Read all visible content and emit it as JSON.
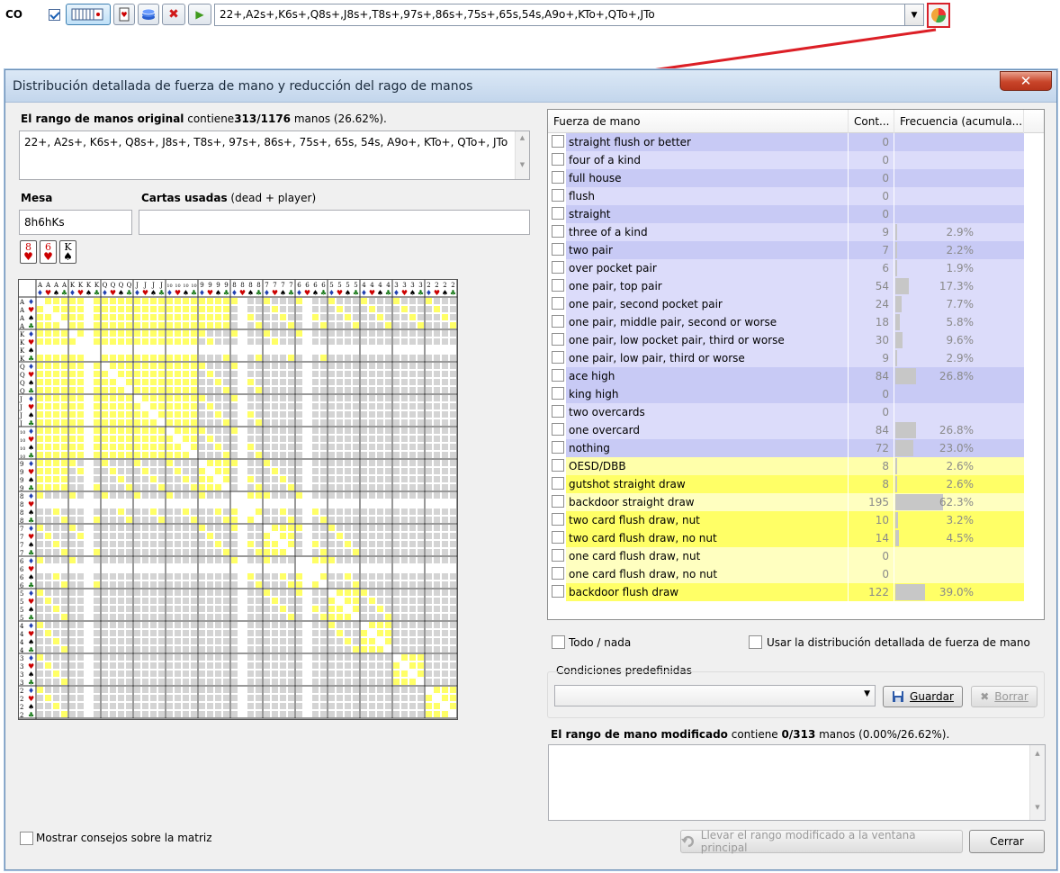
{
  "toolbar": {
    "position_label": "CO",
    "range_text": "22+,A2s+,K6s+,Q8s+,J8s+,T8s+,97s+,86s+,75s+,65s,54s,A9o+,KTo+,QTo+,JTo",
    "dropdown_arrow": "▼",
    "remove_glyph": "✖",
    "go_glyph": "▶"
  },
  "dialog": {
    "title": "Distribución detallada de fuerza de mano y reducción del rago de manos",
    "close_glyph": "✕",
    "original_range": {
      "label_bold": "El rango de manos original",
      "label_mid": " contiene",
      "count_bold": "313/1176",
      "label_tail": " manos (26.62%).",
      "text": "22+, A2s+, K6s+, Q8s+, J8s+, T8s+, 97s+, 86s+, 75s+, 65s, 54s, A9o+, KTo+, QTo+, JTo"
    },
    "board": {
      "label": "Mesa",
      "value": "8h6hKs"
    },
    "dead": {
      "label_bold": "Cartas usadas",
      "label_tail": " (dead + player)",
      "value": ""
    },
    "board_cards": [
      {
        "rank": "8",
        "suit": "♥"
      },
      {
        "rank": "6",
        "suit": "♥"
      },
      {
        "rank": "K",
        "suit": "♠"
      }
    ],
    "matrix": {
      "ranks": [
        "A",
        "K",
        "Q",
        "J",
        "10",
        "9",
        "8",
        "7",
        "6",
        "5",
        "4",
        "3",
        "2"
      ],
      "suits": [
        "♦",
        "♥",
        "♠",
        "♣"
      ],
      "colors": {
        "in_range": "#ffff66",
        "out_range": "#d4d4d4",
        "blocked": "#ffffff"
      }
    },
    "hand_strength": {
      "headers": [
        "Fuerza de mano",
        "Cont...",
        "Frecuencia (acumula..."
      ],
      "rows": [
        {
          "name": "straight flush or better",
          "count": "0",
          "pct": "",
          "freq": 0,
          "color": "#c8caf5"
        },
        {
          "name": "four of a kind",
          "count": "0",
          "pct": "",
          "freq": 0,
          "color": "#dcdcfa"
        },
        {
          "name": "full house",
          "count": "0",
          "pct": "",
          "freq": 0,
          "color": "#c8caf5"
        },
        {
          "name": "flush",
          "count": "0",
          "pct": "",
          "freq": 0,
          "color": "#dcdcfa"
        },
        {
          "name": "straight",
          "count": "0",
          "pct": "",
          "freq": 0,
          "color": "#c8caf5"
        },
        {
          "name": "three of a kind",
          "count": "9",
          "pct": "2.9%",
          "freq": 2.9,
          "color": "#dcdcfa"
        },
        {
          "name": "two pair",
          "count": "7",
          "pct": "2.2%",
          "freq": 2.2,
          "color": "#c8caf5"
        },
        {
          "name": "over pocket pair",
          "count": "6",
          "pct": "1.9%",
          "freq": 1.9,
          "color": "#dcdcfa"
        },
        {
          "name": "one pair, top pair",
          "count": "54",
          "pct": "17.3%",
          "freq": 17.3,
          "color": "#dcdcfa"
        },
        {
          "name": "one pair, second pocket pair",
          "count": "24",
          "pct": "7.7%",
          "freq": 7.7,
          "color": "#dcdcfa"
        },
        {
          "name": "one pair, middle pair, second or worse",
          "count": "18",
          "pct": "5.8%",
          "freq": 5.8,
          "color": "#dcdcfa"
        },
        {
          "name": "one pair, low pocket pair, third or worse",
          "count": "30",
          "pct": "9.6%",
          "freq": 9.6,
          "color": "#dcdcfa"
        },
        {
          "name": "one pair, low pair, third or worse",
          "count": "9",
          "pct": "2.9%",
          "freq": 2.9,
          "color": "#dcdcfa"
        },
        {
          "name": "ace high",
          "count": "84",
          "pct": "26.8%",
          "freq": 26.8,
          "color": "#c8caf5"
        },
        {
          "name": "king high",
          "count": "0",
          "pct": "",
          "freq": 0,
          "color": "#c8caf5"
        },
        {
          "name": "two overcards",
          "count": "0",
          "pct": "",
          "freq": 0,
          "color": "#dcdcfa"
        },
        {
          "name": "one overcard",
          "count": "84",
          "pct": "26.8%",
          "freq": 26.8,
          "color": "#dcdcfa"
        },
        {
          "name": "nothing",
          "count": "72",
          "pct": "23.0%",
          "freq": 23.0,
          "color": "#c8caf5"
        },
        {
          "name": "OESD/DBB",
          "count": "8",
          "pct": "2.6%",
          "freq": 2.6,
          "color": "#ffffaa"
        },
        {
          "name": "gutshot straight draw",
          "count": "8",
          "pct": "2.6%",
          "freq": 2.6,
          "color": "#ffff66"
        },
        {
          "name": "backdoor straight draw",
          "count": "195",
          "pct": "62.3%",
          "freq": 62.3,
          "color": "#ffffc0"
        },
        {
          "name": "two card flush draw, nut",
          "count": "10",
          "pct": "3.2%",
          "freq": 3.2,
          "color": "#ffff66"
        },
        {
          "name": "two card flush draw, no nut",
          "count": "14",
          "pct": "4.5%",
          "freq": 4.5,
          "color": "#ffff66"
        },
        {
          "name": "one card flush draw, nut",
          "count": "0",
          "pct": "",
          "freq": 0,
          "color": "#ffffc0"
        },
        {
          "name": "one card flush draw, no nut",
          "count": "0",
          "pct": "",
          "freq": 0,
          "color": "#ffffc0"
        },
        {
          "name": "backdoor flush draw",
          "count": "122",
          "pct": "39.0%",
          "freq": 39.0,
          "color": "#ffff66"
        }
      ]
    },
    "todo_nada": "Todo / nada",
    "usar_distribucion": "Usar la distribución detallada de fuerza de mano",
    "predefined": {
      "label": "Condiciones predefinidas",
      "value": ""
    },
    "save_button": "Guardar",
    "delete_button": "Borrar",
    "modified_range": {
      "label_bold": "El rango de mano modificado",
      "label_mid": " contiene ",
      "count_bold": "0/313",
      "label_tail": " manos (0.00%/26.62%).",
      "text": ""
    },
    "matrix_tips": "Mostrar consejos sobre la matriz",
    "transfer_button": "Llevar el rango modificado a la ventana principal",
    "close_button": "Cerrar"
  }
}
